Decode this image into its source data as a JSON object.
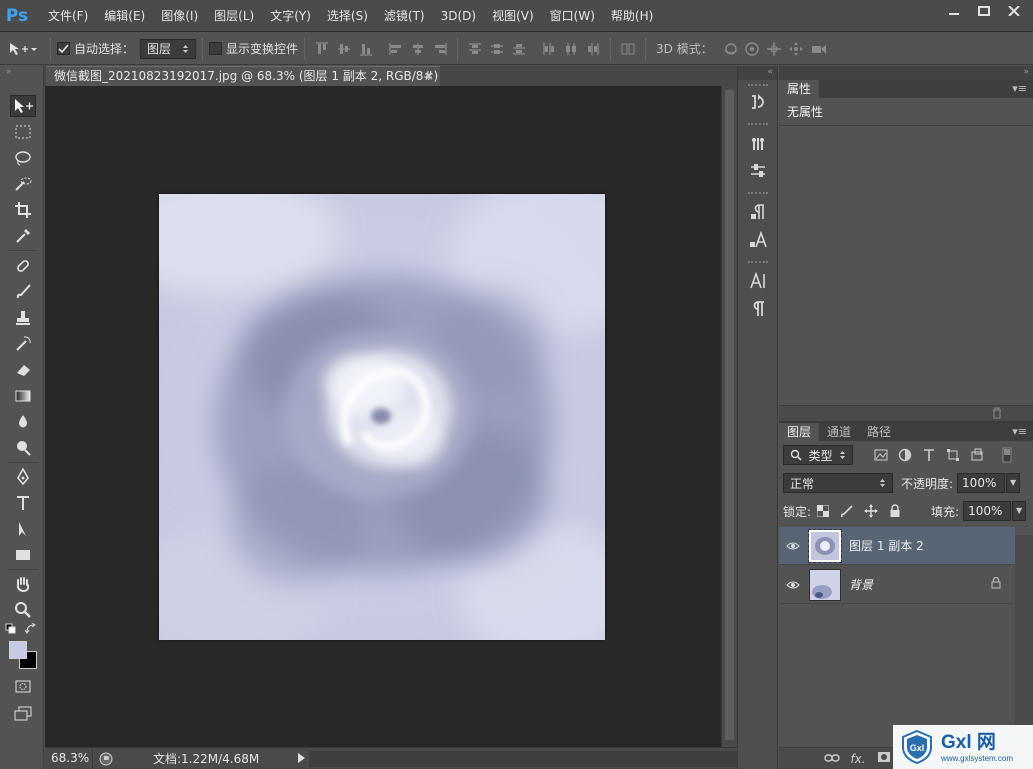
{
  "app": {
    "logo": "Ps"
  },
  "menu": [
    "文件(F)",
    "编辑(E)",
    "图像(I)",
    "图层(L)",
    "文字(Y)",
    "选择(S)",
    "滤镜(T)",
    "3D(D)",
    "视图(V)",
    "窗口(W)",
    "帮助(H)"
  ],
  "options": {
    "auto_select_label": "自动选择：",
    "auto_select_checked": true,
    "auto_select_target": "图层",
    "show_transform_label": "显示变换控件",
    "show_transform_checked": false,
    "mode_3d_label": "3D 模式："
  },
  "document": {
    "tab_title": "微信截图_20210823192017.jpg @ 68.3% (图层 1 副本 2, RGB/8#) *",
    "tab_close": "×"
  },
  "status": {
    "zoom": "68.3%",
    "doc_info": "文档:1.22M/4.68M"
  },
  "colors": {
    "foreground": "#c8c9e4",
    "background": "#000000",
    "selection": "#586575",
    "ps_blue": "#3ca3f5"
  },
  "properties": {
    "tab": "属性",
    "content": "无属性"
  },
  "layers": {
    "tabs": [
      "图层",
      "通道",
      "路径"
    ],
    "filter_kind": "类型",
    "blend_mode": "正常",
    "opacity_label": "不透明度:",
    "opacity_value": "100%",
    "lock_label": "锁定:",
    "fill_label": "填充:",
    "fill_value": "100%",
    "items": [
      {
        "name": "图层 1 副本 2",
        "selected": true,
        "locked": false
      },
      {
        "name": "背景",
        "selected": false,
        "locked": true
      }
    ]
  },
  "watermark": {
    "title": "Gxl 网",
    "subtitle": "www.gxlsystem.com"
  }
}
